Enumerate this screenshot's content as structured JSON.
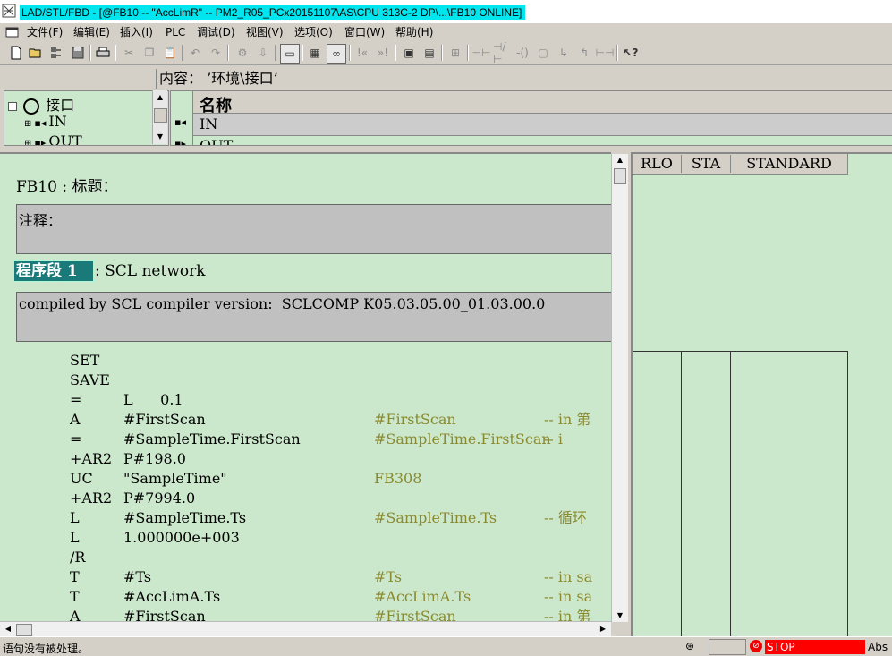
{
  "window": {
    "title": "LAD/STL/FBD  - [@FB10 -- \"AccLimR\" -- PM2_R05_PCx20151107\\AS\\CPU 313C-2 DP\\...\\FB10  ONLINE]"
  },
  "menu": {
    "items": [
      "文件(F)",
      "编辑(E)",
      "插入(I)",
      "PLC",
      "调试(D)",
      "视图(V)",
      "选项(O)",
      "窗口(W)",
      "帮助(H)"
    ]
  },
  "interface": {
    "content_label": "内容：  ’环境\\接口’",
    "tree": {
      "root": "接口",
      "children": [
        "IN",
        "OUT"
      ]
    },
    "table": {
      "header": "名称",
      "rows": [
        "IN",
        "OUT"
      ]
    }
  },
  "block": {
    "header": "FB10 : 标题：",
    "comment_label": "注释：",
    "network": {
      "label": "程序段 1",
      "title": ": SCL network",
      "comment": "compiled by SCL compiler version:  SCLCOMP K05.03.05.00_01.03.00.0"
    },
    "code": [
      {
        "op": "SET",
        "arg": "",
        "sym": "",
        "cmt": ""
      },
      {
        "op": "SAVE",
        "arg": "",
        "sym": "",
        "cmt": ""
      },
      {
        "op": "=",
        "arg": "L      0.1",
        "sym": "",
        "cmt": ""
      },
      {
        "op": "A",
        "arg": "#FirstScan",
        "sym": "#FirstScan",
        "cmt": "-- in 第"
      },
      {
        "op": "=",
        "arg": "#SampleTime.FirstScan",
        "sym": "#SampleTime.FirstScan",
        "cmt": "-- i"
      },
      {
        "op": "+AR2",
        "arg": "P#198.0",
        "sym": "",
        "cmt": ""
      },
      {
        "op": "UC",
        "arg": "\"SampleTime\"",
        "sym": "FB308",
        "cmt": ""
      },
      {
        "op": "+AR2",
        "arg": "P#7994.0",
        "sym": "",
        "cmt": ""
      },
      {
        "op": "L",
        "arg": "#SampleTime.Ts",
        "sym": "#SampleTime.Ts",
        "cmt": "-- 循环"
      },
      {
        "op": "L",
        "arg": "1.000000e+003",
        "sym": "",
        "cmt": ""
      },
      {
        "op": "/R",
        "arg": "",
        "sym": "",
        "cmt": ""
      },
      {
        "op": "T",
        "arg": "#Ts",
        "sym": "#Ts",
        "cmt": "-- in sa"
      },
      {
        "op": "T",
        "arg": "#AccLimA.Ts",
        "sym": "#AccLimA.Ts",
        "cmt": "-- in sa"
      },
      {
        "op": "A",
        "arg": "#FirstScan",
        "sym": "#FirstScan",
        "cmt": "-- in 第"
      }
    ]
  },
  "status_panel": {
    "columns": [
      "RLO",
      "STA",
      "STANDARD"
    ]
  },
  "statusbar": {
    "message": "语句没有被处理。",
    "state": "STOP",
    "mode": "Abs"
  },
  "colors": {
    "editor_bg": "#cce8cc",
    "title_highlight": "#00e5ee",
    "stop_red": "#ff0000",
    "comment_olive": "#8a8a30",
    "network_label_bg": "#1a7a7a"
  }
}
